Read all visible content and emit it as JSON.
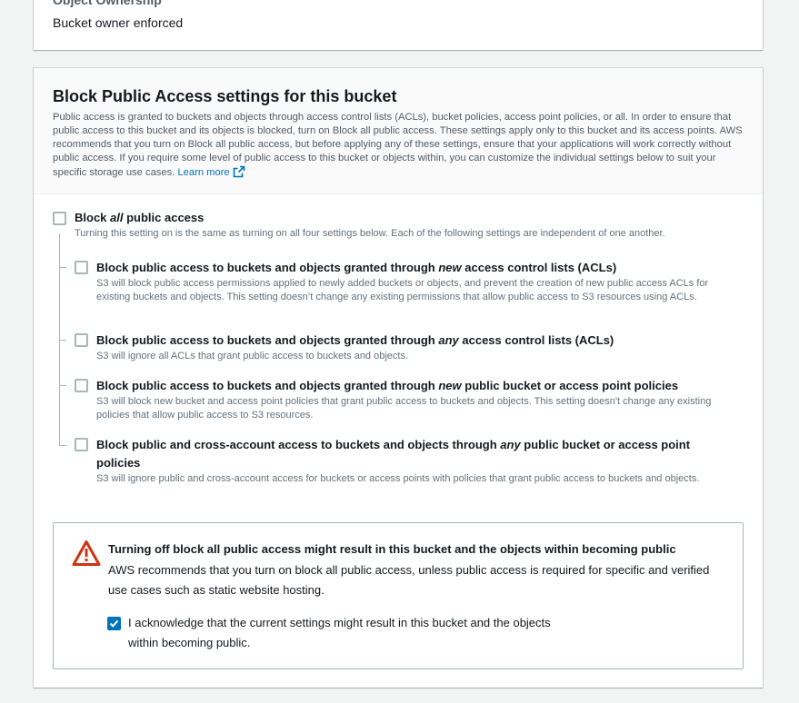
{
  "object_ownership": {
    "section_label": "Object Ownership",
    "value": "Bucket owner enforced"
  },
  "block_public_access": {
    "title": "Block Public Access settings for this bucket",
    "description": "Public access is granted to buckets and objects through access control lists (ACLs), bucket policies, access point policies, or all. In order to ensure that public access to this bucket and its objects is blocked, turn on Block all public access. These settings apply only to this bucket and its access points. AWS recommends that you turn on Block all public access, but before applying any of these settings, ensure that your applications will work correctly without public access. If you require some level of public access to this bucket or objects within, you can customize the individual settings below to suit your specific storage use cases.",
    "learn_more": "Learn more",
    "block_all": {
      "title_pre": "Block ",
      "title_em": "all",
      "title_post": " public access",
      "description": "Turning this setting on is the same as turning on all four settings below. Each of the following settings are independent of one another.",
      "checked": false
    },
    "options": [
      {
        "title_pre": "Block public access to buckets and objects granted through ",
        "title_em": "new",
        "title_post": " access control lists (ACLs)",
        "description": "S3 will block public access permissions applied to newly added buckets or objects, and prevent the creation of new public access ACLs for existing buckets and objects. This setting doesn’t change any existing permissions that allow public access to S3 resources using ACLs.",
        "checked": false
      },
      {
        "title_pre": "Block public access to buckets and objects granted through ",
        "title_em": "any",
        "title_post": " access control lists (ACLs)",
        "description": "S3 will ignore all ACLs that grant public access to buckets and objects.",
        "checked": false
      },
      {
        "title_pre": "Block public access to buckets and objects granted through ",
        "title_em": "new",
        "title_post": " public bucket or access point policies",
        "description": "S3 will block new bucket and access point policies that grant public access to buckets and objects. This setting doesn't change any existing policies that allow public access to S3 resources.",
        "checked": false
      },
      {
        "title_pre": "Block public and cross-account access to buckets and objects through ",
        "title_em": "any",
        "title_post": " public bucket or access point policies",
        "description": "S3 will ignore public and cross-account access for buckets or access points with policies that grant public access to buckets and objects.",
        "checked": false
      }
    ],
    "warning": {
      "icon": "warning-triangle-icon",
      "title": "Turning off block all public access might result in this bucket and the objects within becoming public",
      "body": "AWS recommends that you turn on block all public access, unless public access is required for specific and verified use cases such as static website hosting.",
      "acknowledge_label": "I acknowledge that the current settings might result in this bucket and the objects within becoming public.",
      "acknowledged": true
    }
  },
  "colors": {
    "accent": "#0073bb",
    "warning": "#d13212",
    "border": "#aab7b8"
  }
}
